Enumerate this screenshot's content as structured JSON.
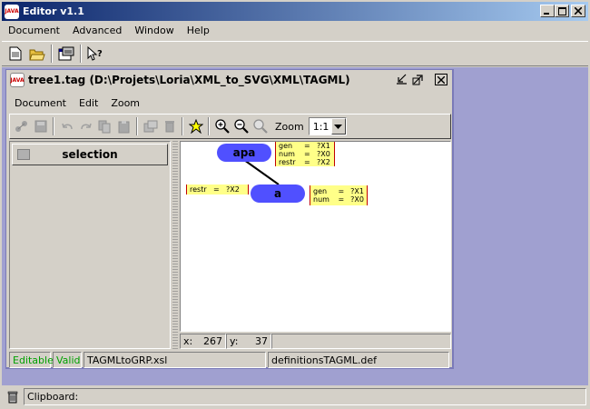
{
  "app": {
    "title": "Editor v1.1",
    "icon_text": "JAVA"
  },
  "menubar": {
    "items": [
      "Document",
      "Advanced",
      "Window",
      "Help"
    ]
  },
  "toolbar": {
    "icons": [
      "new-document-icon",
      "open-folder-icon",
      "properties-icon",
      "context-help-icon"
    ]
  },
  "frame": {
    "title": "tree1.tag  (D:\\Projets\\Loria\\XML_to_SVG\\XML\\TAGML)",
    "menu": [
      "Document",
      "Edit",
      "Zoom"
    ],
    "toolbar_icons": [
      "tree-icon",
      "save-icon",
      "undo-icon",
      "redo-icon",
      "copy-icon",
      "paste-icon",
      "properties-icon",
      "delete-icon",
      "star-icon",
      "zoom-in-icon",
      "zoom-out-icon",
      "zoom-fit-icon"
    ],
    "zoom_label": "Zoom",
    "zoom_value": "1:1",
    "left_panel_button": "selection",
    "coord": {
      "x_label": "x:",
      "x_value": "267",
      "y_label": "y:",
      "y_value": "37"
    },
    "status": {
      "editable": "Editable",
      "valid": "Valid",
      "xsl": "TAGMLtoGRP.xsl",
      "def": "definitionsTAGML.def"
    },
    "status_color": "#00a000"
  },
  "graph": {
    "node_color": "#5050ff",
    "feature_color": "#ffff88",
    "nodes": [
      {
        "label": "apa",
        "features": [
          {
            "k": "gen",
            "eq": "=",
            "v": "?X1"
          },
          {
            "k": "num",
            "eq": "=",
            "v": "?X0"
          },
          {
            "k": "restr",
            "eq": "=",
            "v": "?X2"
          }
        ]
      },
      {
        "label": "a",
        "left_features": [
          {
            "k": "restr",
            "eq": "=",
            "v": "?X2"
          }
        ],
        "features": [
          {
            "k": "gen",
            "eq": "=",
            "v": "?X1"
          },
          {
            "k": "num",
            "eq": "=",
            "v": "?X0"
          }
        ]
      }
    ]
  },
  "bottom": {
    "clipboard_label": "Clipboard:"
  }
}
